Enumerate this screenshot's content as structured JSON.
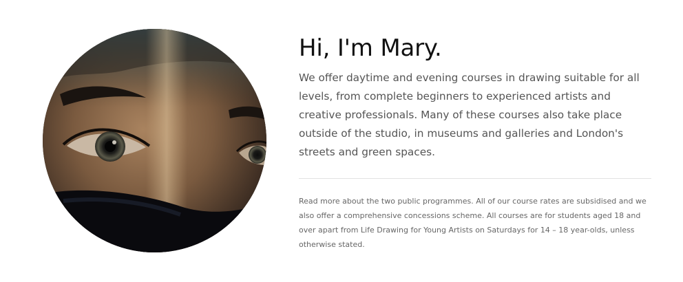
{
  "intro": {
    "heading": "Hi, I'm Mary.",
    "lead": "We offer daytime and evening courses in drawing suitable for all levels, from complete beginners to experienced artists and creative professionals. Many of these courses also take place outside of the studio, in museums and galleries and London's streets and green spaces.",
    "note": "Read more about the two public programmes. All of our course rates are subsidised and we also offer a comprehensive concessions scheme. All courses are for students aged 18 and over apart from Life Drawing for Young Artists on Saturdays for 14 – 18 year-olds, unless otherwise stated."
  },
  "colors": {
    "heading": "#111111",
    "body_text": "#555555",
    "note_text": "#666666",
    "divider": "#e2e2e2"
  }
}
